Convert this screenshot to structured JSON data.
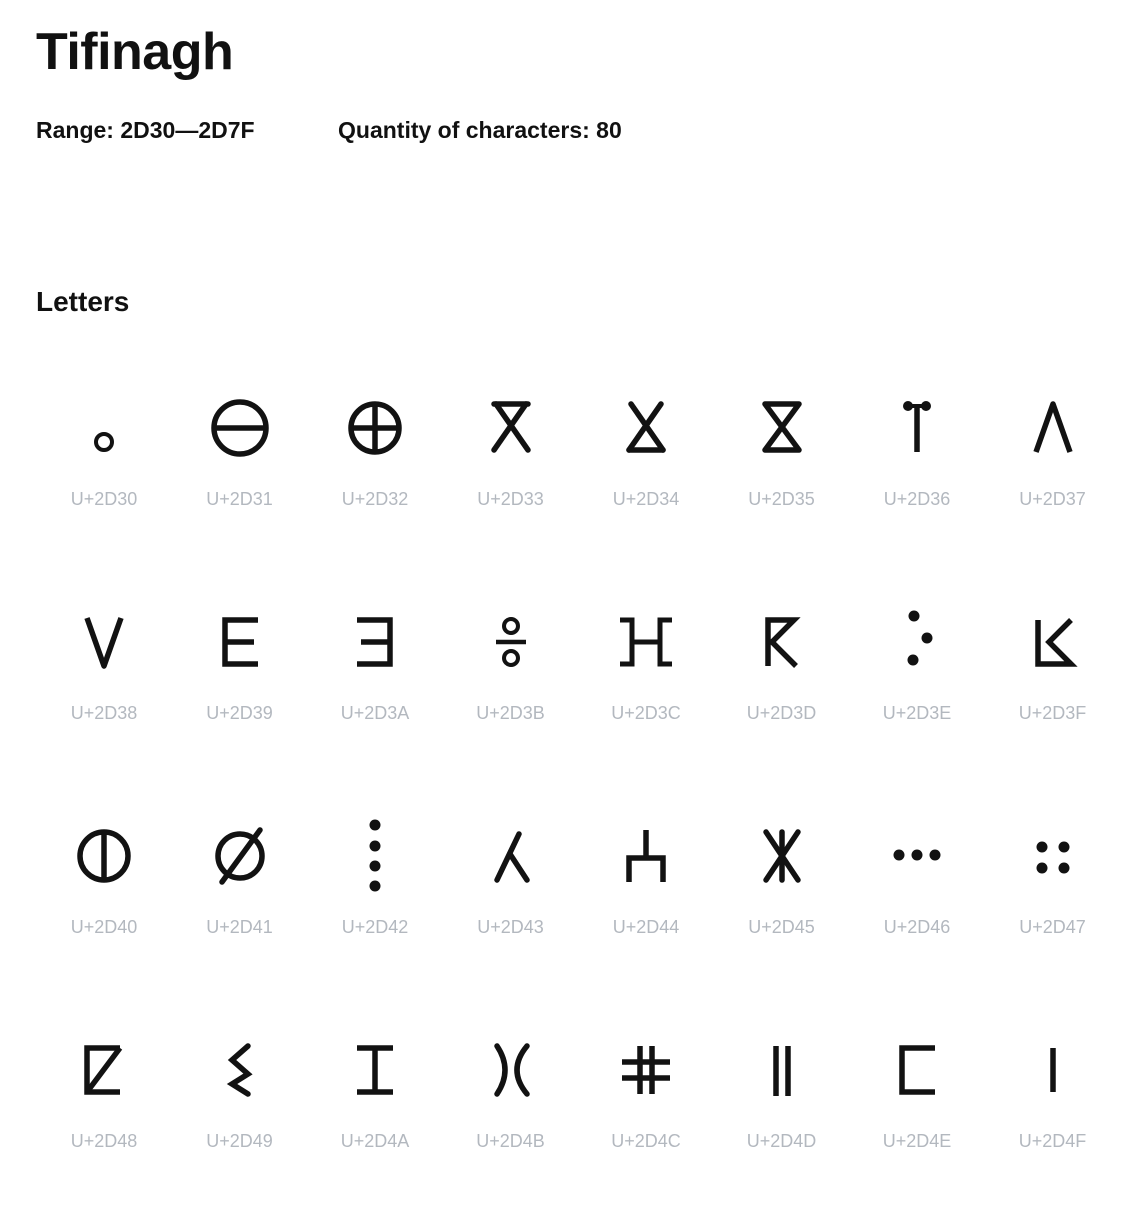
{
  "page": {
    "title": "Tifinagh",
    "range": "Range: 2D30—2D7F",
    "quantity": "Quantity of characters: 80"
  },
  "section": {
    "title": "Letters"
  },
  "glyphs": [
    {
      "code": "U+2D30",
      "icon": "ring-glyph-icon"
    },
    {
      "code": "U+2D31",
      "icon": "circle-horizontal-bar-icon"
    },
    {
      "code": "U+2D32",
      "icon": "circle-cross-icon"
    },
    {
      "code": "U+2D33",
      "icon": "hourglass-open-top-icon"
    },
    {
      "code": "U+2D34",
      "icon": "hourglass-closed-bottom-icon"
    },
    {
      "code": "U+2D35",
      "icon": "hourglass-closed-icon"
    },
    {
      "code": "U+2D36",
      "icon": "stem-with-two-dots-icon"
    },
    {
      "code": "U+2D37",
      "icon": "caret-up-icon"
    },
    {
      "code": "U+2D38",
      "icon": "v-shape-icon"
    },
    {
      "code": "U+2D39",
      "icon": "letter-e-shape-icon"
    },
    {
      "code": "U+2D3A",
      "icon": "reversed-e-shape-icon"
    },
    {
      "code": "U+2D3B",
      "icon": "ring-bar-ring-icon"
    },
    {
      "code": "U+2D3C",
      "icon": "double-bracket-h-icon"
    },
    {
      "code": "U+2D3D",
      "icon": "k-with-hook-icon"
    },
    {
      "code": "U+2D3E",
      "icon": "three-dots-triangle-icon"
    },
    {
      "code": "U+2D3F",
      "icon": "k-with-base-icon"
    },
    {
      "code": "U+2D40",
      "icon": "circle-vertical-bar-icon"
    },
    {
      "code": "U+2D41",
      "icon": "circle-slash-icon"
    },
    {
      "code": "U+2D42",
      "icon": "four-dots-vertical-icon"
    },
    {
      "code": "U+2D43",
      "icon": "lambda-shape-icon"
    },
    {
      "code": "U+2D44",
      "icon": "trident-shape-icon"
    },
    {
      "code": "U+2D45",
      "icon": "x-with-center-bar-icon"
    },
    {
      "code": "U+2D46",
      "icon": "three-dots-horizontal-icon"
    },
    {
      "code": "U+2D47",
      "icon": "four-dots-square-icon"
    },
    {
      "code": "U+2D48",
      "icon": "box-with-diagonal-icon"
    },
    {
      "code": "U+2D49",
      "icon": "zigzag-shape-icon"
    },
    {
      "code": "U+2D4A",
      "icon": "capital-i-shape-icon"
    },
    {
      "code": "U+2D4B",
      "icon": "double-arc-icon"
    },
    {
      "code": "U+2D4C",
      "icon": "hash-shape-icon"
    },
    {
      "code": "U+2D4D",
      "icon": "double-bar-icon"
    },
    {
      "code": "U+2D4E",
      "icon": "open-square-bracket-icon"
    },
    {
      "code": "U+2D4F",
      "icon": "vertical-bar-icon"
    }
  ]
}
